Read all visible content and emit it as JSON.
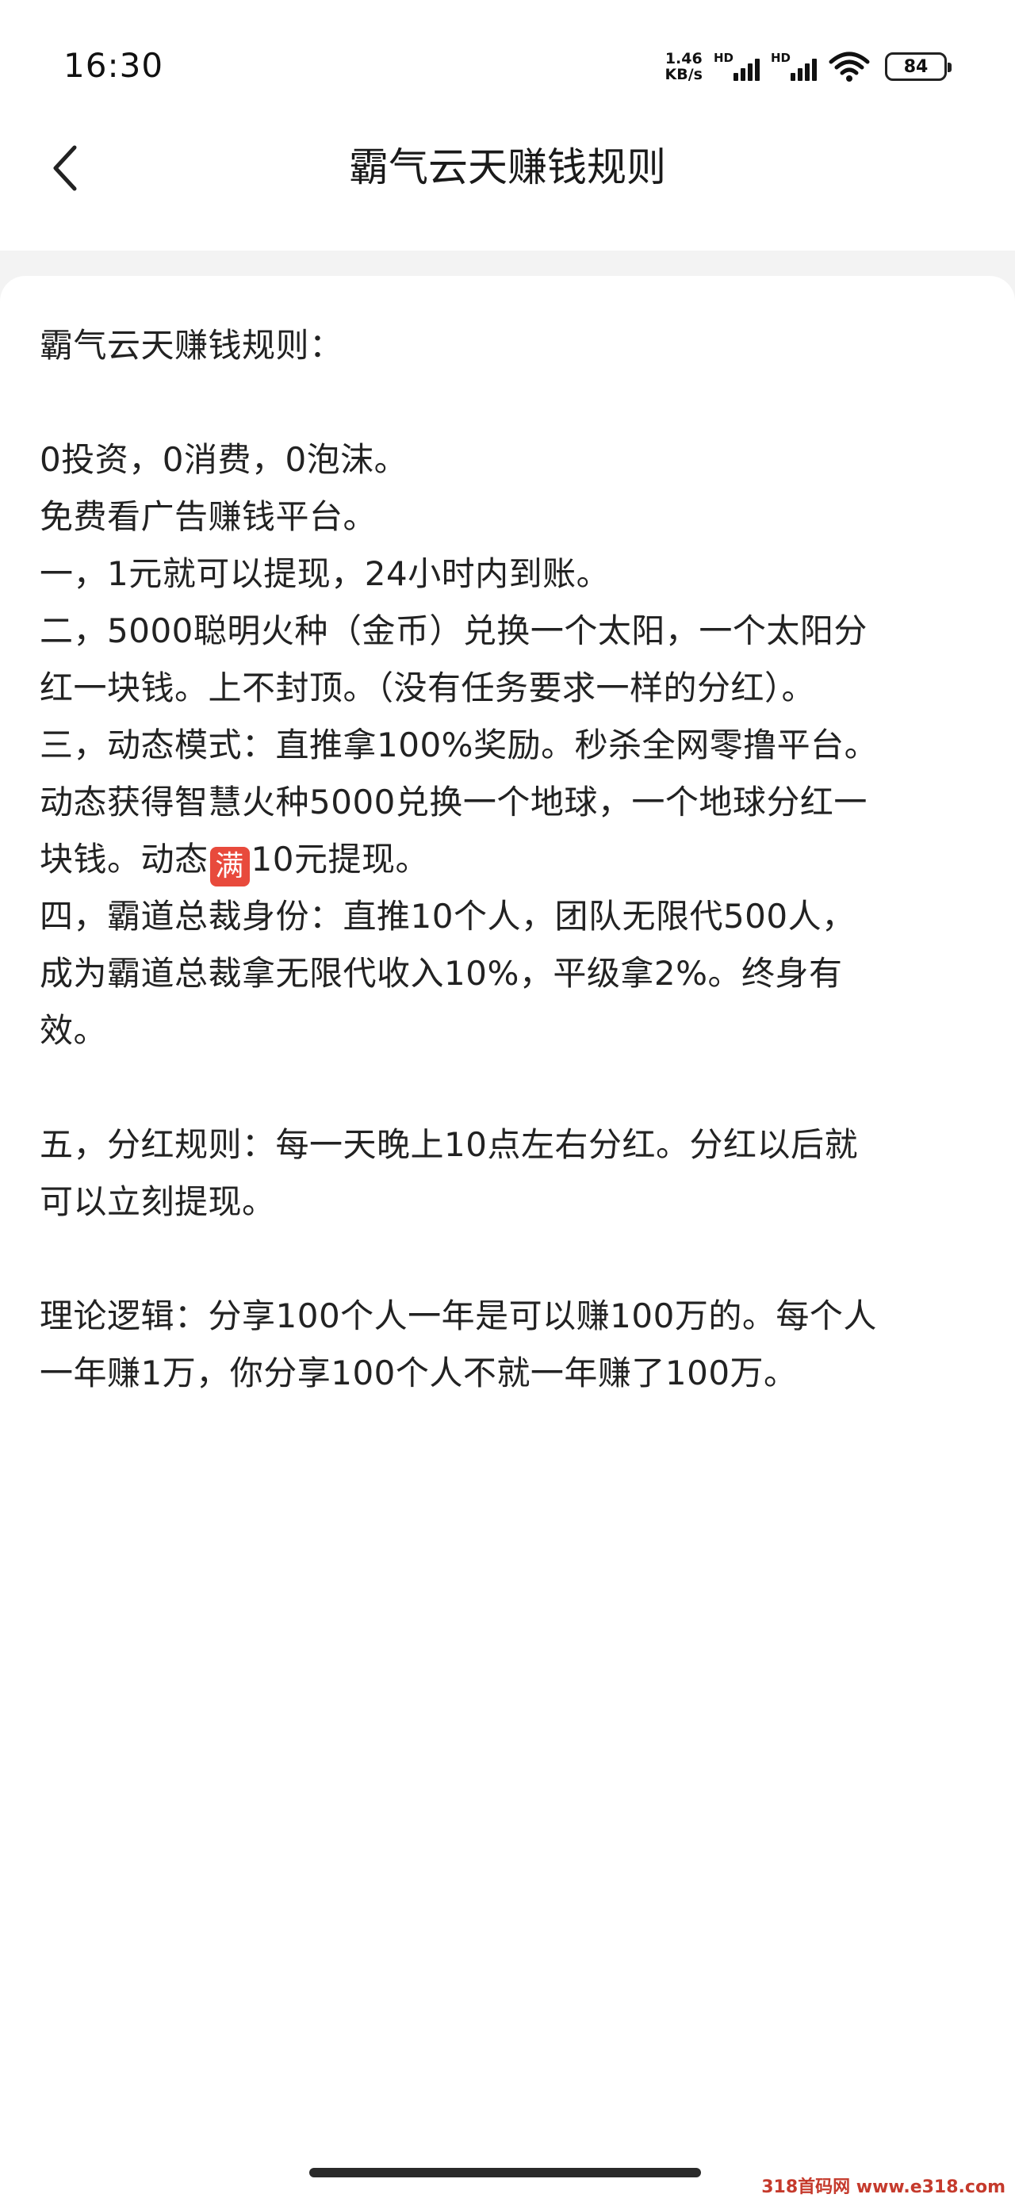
{
  "status_bar": {
    "time": "16:30",
    "net_speed_value": "1.46",
    "net_speed_unit": "KB/s",
    "sim1_label": "HD",
    "sim2_label": "HD",
    "battery": "84",
    "icons": [
      "signal-icon",
      "signal-icon",
      "wifi-icon",
      "battery-icon"
    ]
  },
  "nav": {
    "title": "霸气云天赚钱规则",
    "back_icon": "chevron-left-icon"
  },
  "content": {
    "lines": [
      "霸气云天赚钱规则：",
      "",
      "0投资，0消费，0泡沫。",
      "免费看广告赚钱平台。",
      "一，1元就可以提现，24小时内到账。",
      "二，5000聪明火种（金币）兑换一个太阳，一个太阳分",
      "红一块钱。上不封顶。（没有任务要求一样的分红）。",
      "三，动态模式：直推拿100%奖励。秒杀全网零撸平台。",
      "动态获得智慧火种5000兑换一个地球，一个地球分红一",
      "块钱。动态",
      "四，霸道总裁身份：直推10个人，团队无限代500人，",
      "成为霸道总裁拿无限代收入10%，平级拿2%。终身有",
      "效。",
      "",
      "五，分红规则：每一天晚上10点左右分红。分红以后就",
      "可以立刻提现。",
      "",
      "理论逻辑：分享100个人一年是可以赚100万的。每个人",
      "一年赚1万，你分享100个人不就一年赚了100万。"
    ],
    "badge_text": "满",
    "badge_suffix": "10元提现。"
  },
  "watermark": "318首码网 www.e318.com",
  "colors": {
    "badge": "#e84a3c",
    "background": "#f3f3f3",
    "card": "#ffffff"
  }
}
